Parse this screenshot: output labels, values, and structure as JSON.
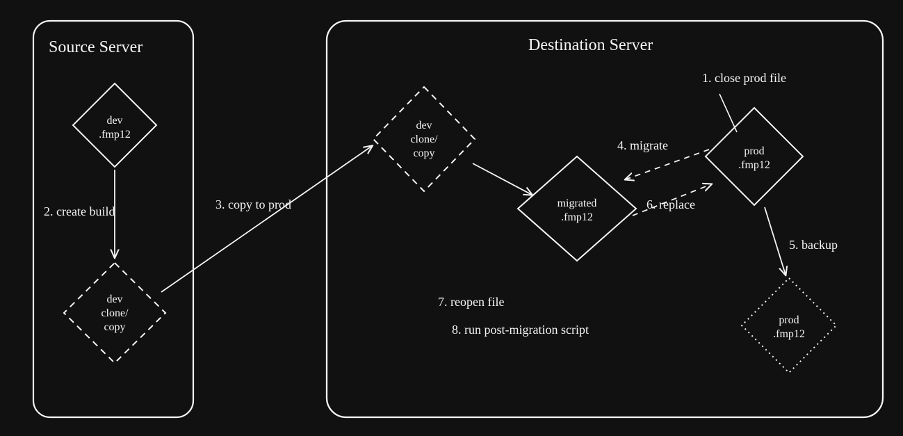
{
  "servers": {
    "source": {
      "title": "Source Server"
    },
    "destination": {
      "title": "Destination Server"
    }
  },
  "nodes": {
    "source_dev": {
      "line1": "dev",
      "line2": ".fmp12"
    },
    "source_dev_clone": {
      "line1": "dev",
      "line2": "clone/",
      "line3": "copy"
    },
    "dest_dev_clone": {
      "line1": "dev",
      "line2": "clone/",
      "line3": "copy"
    },
    "migrated": {
      "line1": "migrated",
      "line2": ".fmp12"
    },
    "prod": {
      "line1": "prod",
      "line2": ".fmp12"
    },
    "prod_backup": {
      "line1": "prod",
      "line2": ".fmp12"
    }
  },
  "steps": {
    "s1": "1. close prod file",
    "s2": "2. create build",
    "s3": "3. copy to prod",
    "s4": "4. migrate",
    "s5": "5. backup",
    "s6": "6. replace",
    "s7": "7. reopen file",
    "s8": "8. run post-migration script"
  }
}
